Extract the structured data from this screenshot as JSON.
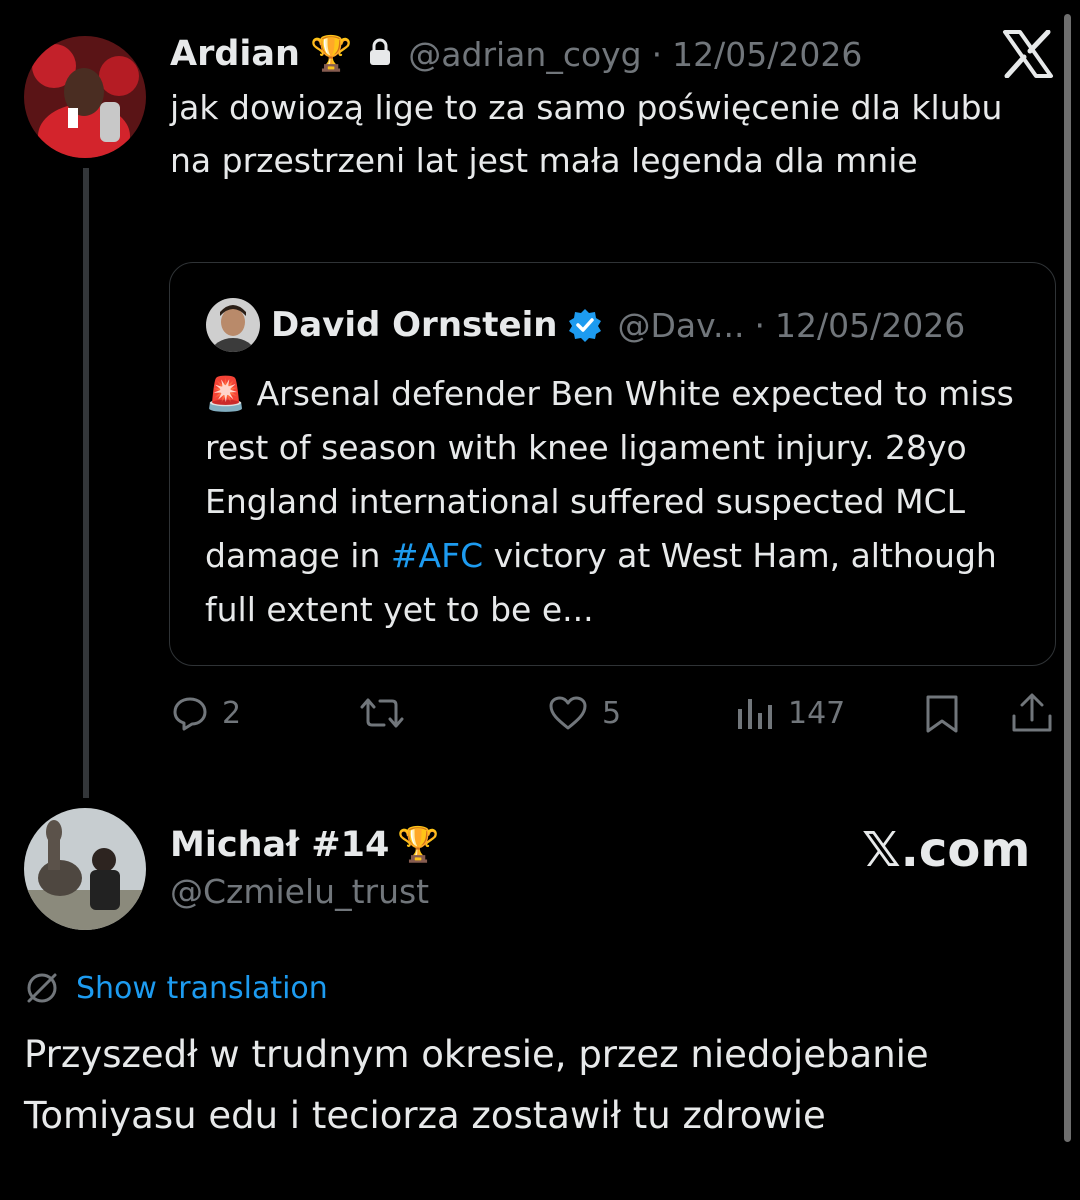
{
  "close_x_logo": "X",
  "tweet1": {
    "author": "Ardian",
    "trophy": "🏆",
    "handle": "@adrian_coyg",
    "separator": "·",
    "date": "12/05/2026",
    "text": "jak dowiozą lige to za samo poświęcenie dla klubu na przestrzeni lat jest mała legenda dla mnie",
    "quote": {
      "author": "David Ornstein",
      "handle": "@Dav...",
      "separator": "·",
      "date": "12/05/2026",
      "siren": "🚨",
      "text_before": " Arsenal defender Ben White expected to miss rest of season with knee ligament injury. 28yo England international suffered suspected MCL damage in ",
      "hashtag": "#AFC",
      "text_after": " victory at West Ham, although full extent yet to be e..."
    },
    "actions": {
      "replies": "2",
      "likes": "5",
      "views": "147"
    }
  },
  "tweet2": {
    "author": "Michał #14",
    "trophy": "🏆",
    "handle": "@Czmielu_trust",
    "brand": "𝕏.com",
    "show_translation": "Show translation",
    "text": "Przyszedł w trudnym okresie, przez niedojebanie Tomiyasu edu i teciorza zostawił tu zdrowie"
  },
  "colors": {
    "background": "#000000",
    "text": "#e7e9ea",
    "muted": "#71767b",
    "link": "#1d9bf0",
    "verified": "#1d9bf0",
    "border": "#2f3336"
  }
}
